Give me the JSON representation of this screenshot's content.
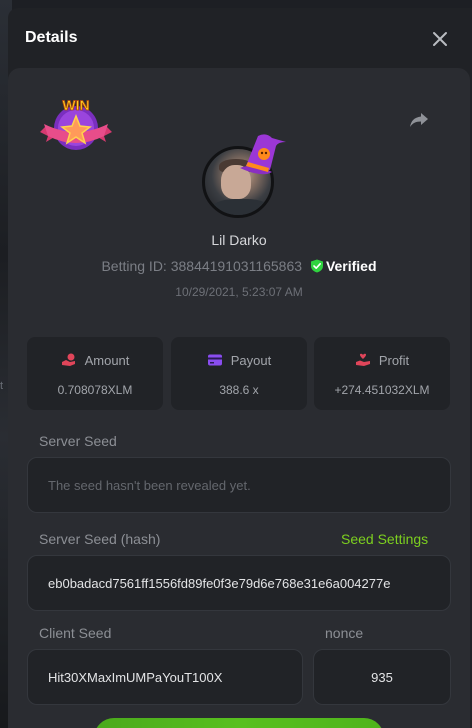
{
  "modal": {
    "title": "Details"
  },
  "backdrop": {
    "peek_text": "t"
  },
  "bet": {
    "username": "Lil Darko",
    "betting_id_label": "Betting ID:",
    "betting_id": "38844191031165863",
    "verified_label": "Verified",
    "timestamp": "10/29/2021, 5:23:07 AM"
  },
  "stats": {
    "amount": {
      "label": "Amount",
      "value": "0.708078XLM"
    },
    "payout": {
      "label": "Payout",
      "value": "388.6 x"
    },
    "profit": {
      "label": "Profit",
      "value": "+274.451032XLM"
    }
  },
  "seeds": {
    "server_seed_label": "Server Seed",
    "server_seed_placeholder": "The seed hasn't been revealed yet.",
    "server_seed_hash_label": "Server Seed (hash)",
    "seed_settings_label": "Seed Settings",
    "server_seed_hash": "eb0badacd7561ff1556fd89fe0f3e79d6e768e31e6a004277e",
    "client_seed_label": "Client Seed",
    "client_seed": "Hit30XMaxImUMPaYouT100X",
    "nonce_label": "nonce",
    "nonce": "935"
  },
  "badge_text": "WIN",
  "colors": {
    "accent_green": "#7ccf1f",
    "verified_green": "#2fd33f",
    "amount_icon": "#e0455a",
    "payout_icon": "#8a4df0",
    "profit_icon": "#e0455a"
  },
  "icons": {
    "close": "close-icon",
    "share": "share-icon",
    "verified": "shield-check-icon",
    "amount": "coins-hand-icon",
    "payout": "card-icon",
    "profit": "hand-heart-icon"
  }
}
